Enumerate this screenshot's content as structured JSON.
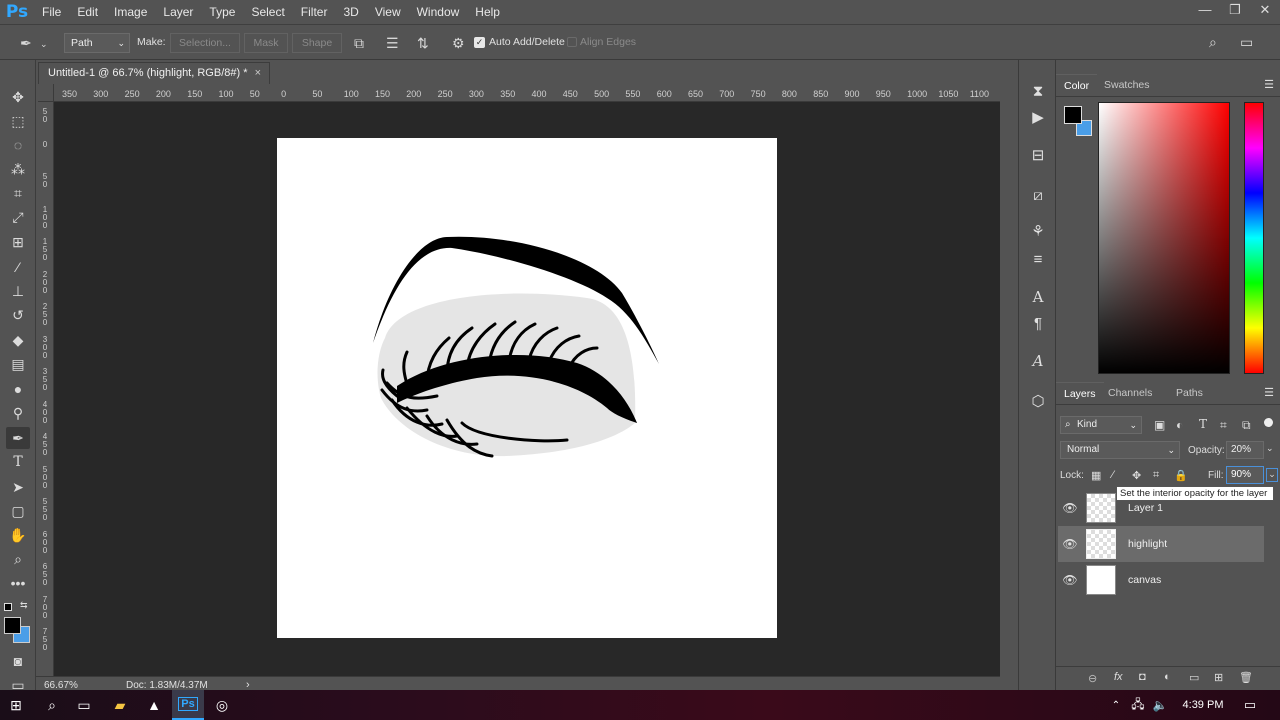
{
  "app": {
    "logo": "Ps"
  },
  "menu": [
    "File",
    "Edit",
    "Image",
    "Layer",
    "Type",
    "Select",
    "Filter",
    "3D",
    "View",
    "Window",
    "Help"
  ],
  "window_controls": {
    "minimize": "—",
    "restore": "❐",
    "close": "✕"
  },
  "options": {
    "mode": "Path",
    "make_label": "Make:",
    "selection_btn": "Selection...",
    "mask_btn": "Mask",
    "shape_btn": "Shape",
    "auto_add_delete": "Auto Add/Delete",
    "align_edges": "Align Edges"
  },
  "document": {
    "tab_title": "Untitled-1 @ 66.7% (highlight, RGB/8#) *",
    "close": "×"
  },
  "ruler_h": [
    "350",
    "300",
    "250",
    "200",
    "150",
    "100",
    "50",
    "0",
    "50",
    "100",
    "150",
    "200",
    "250",
    "300",
    "350",
    "400",
    "450",
    "500",
    "550",
    "600",
    "650",
    "700",
    "750",
    "800",
    "850",
    "900",
    "950",
    "1000",
    "1050",
    "1100"
  ],
  "ruler_v": [
    "5\n0",
    "0",
    "5\n0",
    "1\n0\n0",
    "1\n5\n0",
    "2\n0\n0",
    "2\n5\n0",
    "3\n0\n0",
    "3\n5\n0",
    "4\n0\n0",
    "4\n5\n0",
    "5\n0\n0",
    "5\n5\n0",
    "6\n0\n0",
    "6\n5\n0",
    "7\n0\n0",
    "7\n5\n0"
  ],
  "status": {
    "zoom": "66.67%",
    "doc": "Doc: 1.83M/4.37M",
    "arrow": "›"
  },
  "color_panel": {
    "tabs": [
      "Color",
      "Swatches"
    ],
    "foreground": "#000000",
    "background": "#4a9ee8",
    "hue": "#ff0000"
  },
  "layers_panel": {
    "tabs": [
      "Layers",
      "Channels",
      "Paths"
    ],
    "kind": "Kind",
    "blend_mode": "Normal",
    "opacity_label": "Opacity:",
    "opacity_value": "20%",
    "lock_label": "Lock:",
    "fill_label": "Fill:",
    "fill_value": "90%",
    "tooltip": "Set the interior opacity for the layer",
    "layers": [
      {
        "name": "Layer 1",
        "selected": false
      },
      {
        "name": "highlight",
        "selected": true
      },
      {
        "name": "canvas",
        "selected": false
      }
    ]
  },
  "taskbar": {
    "time": "4:39 PM"
  },
  "colors": {
    "ui_bg": "#535353",
    "dark_bg": "#282828",
    "accent": "#31a8ff",
    "selected_layer": "#6b6b6b"
  }
}
